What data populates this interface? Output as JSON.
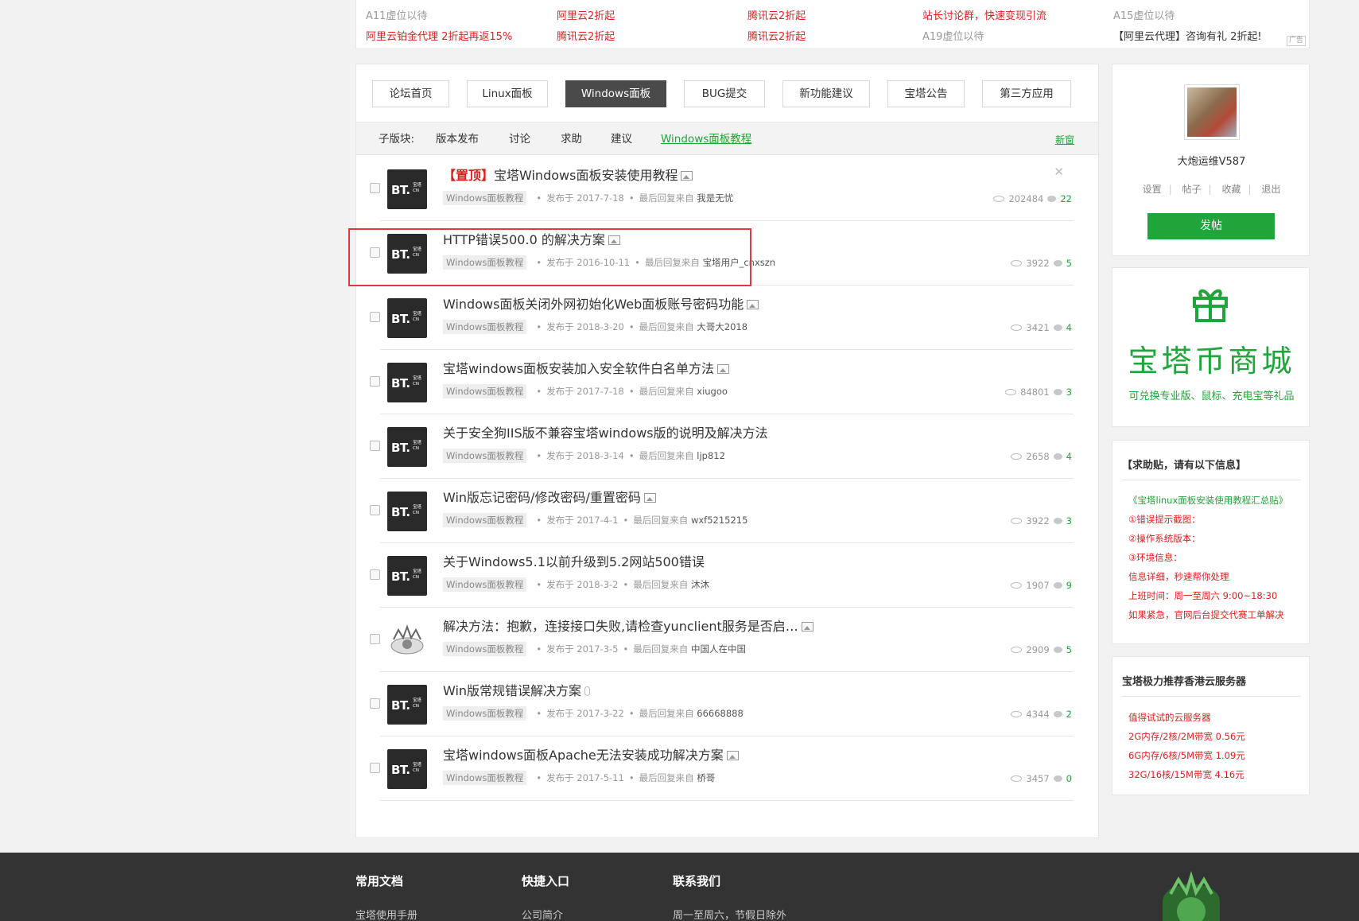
{
  "ads": {
    "row1": [
      "A11虚位以待",
      "阿里云2折起",
      "腾讯云2折起",
      "站长讨论群，快速变现引流",
      "A15虚位以待"
    ],
    "row2": [
      "阿里云铂金代理 2折起再返15%",
      "腾讯云2折起",
      "腾讯云2折起",
      "A19虚位以待",
      "【阿里云代理】咨询有礼 2折起!"
    ],
    "tag": "广告"
  },
  "tabs": [
    "论坛首页",
    "Linux面板",
    "Windows面板",
    "BUG提交",
    "新功能建议",
    "宝塔公告",
    "第三方应用"
  ],
  "active_tab": "Windows面板",
  "subforum": {
    "label": "子版块:",
    "items": [
      "版本发布",
      "讨论",
      "求助",
      "建议",
      "Windows面板教程"
    ],
    "new_window": "新窗"
  },
  "threads": [
    {
      "pinned": "【置顶】",
      "title": "宝塔Windows面板安装使用教程",
      "icon": "image-icon",
      "category": "Windows面板教程",
      "posted": "发布于 2017-7-18",
      "last_reply_label": "最后回复来自",
      "last_reply_user": "我是无忧",
      "views": "202484",
      "replies": "22"
    },
    {
      "pinned": "",
      "title": "HTTP错误500.0 的解决方案",
      "icon": "image-icon",
      "category": "Windows面板教程",
      "posted": "发布于 2016-10-11",
      "last_reply_label": "最后回复来自",
      "last_reply_user": "宝塔用户_cnxszn",
      "views": "3922",
      "replies": "5"
    },
    {
      "pinned": "",
      "title": "Windows面板关闭外网初始化Web面板账号密码功能",
      "icon": "image-icon",
      "category": "Windows面板教程",
      "posted": "发布于 2018-3-20",
      "last_reply_label": "最后回复来自",
      "last_reply_user": "大哥大2018",
      "views": "3421",
      "replies": "4"
    },
    {
      "pinned": "",
      "title": "宝塔windows面板安装加入安全软件白名单方法",
      "icon": "image-icon",
      "category": "Windows面板教程",
      "posted": "发布于 2017-7-18",
      "last_reply_label": "最后回复来自",
      "last_reply_user": "xiugoo",
      "views": "84801",
      "replies": "3"
    },
    {
      "pinned": "",
      "title": "关于安全狗IIS版不兼容宝塔windows版的说明及解决方法",
      "icon": "",
      "category": "Windows面板教程",
      "posted": "发布于 2018-3-14",
      "last_reply_label": "最后回复来自",
      "last_reply_user": "ljp812",
      "views": "2658",
      "replies": "4"
    },
    {
      "pinned": "",
      "title": "Win版忘记密码/修改密码/重置密码",
      "icon": "image-icon",
      "category": "Windows面板教程",
      "posted": "发布于 2017-4-1",
      "last_reply_label": "最后回复来自",
      "last_reply_user": "wxf5215215",
      "views": "3922",
      "replies": "3"
    },
    {
      "pinned": "",
      "title": "关于Windows5.1以前升级到5.2网站500错误",
      "icon": "",
      "category": "Windows面板教程",
      "posted": "发布于 2018-3-2",
      "last_reply_label": "最后回复来自",
      "last_reply_user": "沐沐",
      "views": "1907",
      "replies": "9"
    },
    {
      "pinned": "",
      "title": "解决方法：抱歉，连接接口失败,请检查yunclient服务是否启…",
      "icon": "image-icon",
      "category": "Windows面板教程",
      "posted": "发布于 2017-3-5",
      "last_reply_label": "最后回复来自",
      "last_reply_user": "中国人在中国",
      "views": "2909",
      "replies": "5"
    },
    {
      "pinned": "",
      "title": "Win版常规错误解决方案",
      "icon": "attachment-icon",
      "category": "Windows面板教程",
      "posted": "发布于 2017-3-22",
      "last_reply_label": "最后回复来自",
      "last_reply_user": "66668888",
      "views": "4344",
      "replies": "2"
    },
    {
      "pinned": "",
      "title": "宝塔windows面板Apache无法安装成功解决方案",
      "icon": "image-icon",
      "category": "Windows面板教程",
      "posted": "发布于 2017-5-11",
      "last_reply_label": "最后回复来自",
      "last_reply_user": "桥哥",
      "views": "3457",
      "replies": "0"
    }
  ],
  "bt_logo": {
    "text": "BT.",
    "sub1": "宝塔",
    "sub2": "CN"
  },
  "user": {
    "name": "大炮运维V587",
    "links": [
      "设置",
      "帖子",
      "收藏",
      "退出"
    ],
    "post_button": "发帖"
  },
  "shop": {
    "title": "宝塔币商城",
    "subtitle": "可兑换专业版、鼠标、充电宝等礼品"
  },
  "help": {
    "title": "【求助贴，请有以下信息】",
    "link": "《宝塔linux面板安装使用教程汇总贴》",
    "lines": [
      "①错误提示截图：",
      "②操作系统版本：",
      "③环境信息：",
      "信息详细，秒速帮你处理",
      "上班时间：周一至周六 9:00~18:30",
      "如果紧急，官网后台提交代赛工单解决"
    ]
  },
  "hk": {
    "title": "宝塔极力推荐香港云服务器",
    "lines": [
      "值得试试的云服务器",
      "2G内存/2核/2M带宽 0.56元",
      "6G内存/6核/5M带宽 1.09元",
      "32G/16核/15M带宽 4.16元"
    ]
  },
  "footer": {
    "cols": [
      {
        "heading": "常用文档",
        "item": "宝塔使用手册"
      },
      {
        "heading": "快捷入口",
        "item": "公司简介"
      },
      {
        "heading": "联系我们",
        "item": "周一至周六，节假日除外"
      }
    ]
  },
  "colors": {
    "brand_green": "#20a53a",
    "ad_red": "#e02020",
    "highlight_red": "#e03b3b",
    "footer_bg": "#333333"
  }
}
